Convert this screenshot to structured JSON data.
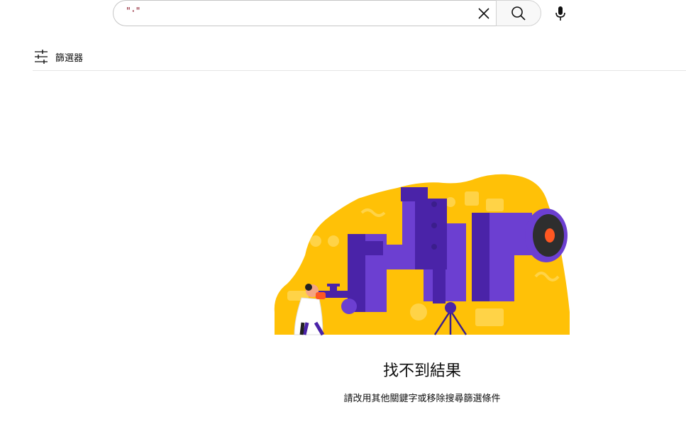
{
  "search": {
    "value": "\"·\"",
    "clear_icon": "close-icon",
    "search_icon": "search-icon",
    "mic_icon": "microphone-icon"
  },
  "filters": {
    "label": "篩選器",
    "icon": "sliders-icon"
  },
  "empty_state": {
    "title": "找不到結果",
    "subtitle": "請改用其他關鍵字或移除搜尋篩選條件"
  },
  "colors": {
    "illustration_yellow": "#FFC107",
    "illustration_purple": "#6C3FD1",
    "illustration_dark_purple": "#4A23A8",
    "lens_orange": "#FF5722"
  }
}
